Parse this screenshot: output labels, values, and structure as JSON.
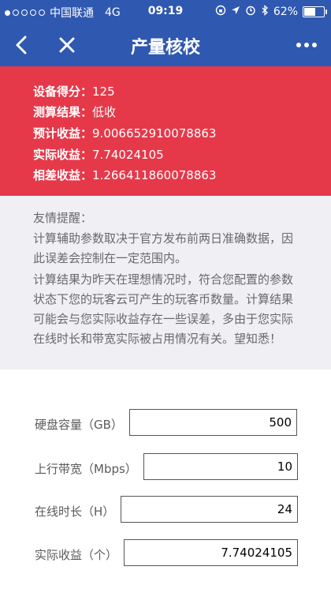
{
  "statusbar": {
    "carrier": "中国联通",
    "network": "4G",
    "time": "09:19",
    "battery": "62%",
    "battery_level": 0.62
  },
  "navbar": {
    "title": "产量核校"
  },
  "result": {
    "rows": [
      {
        "label": "设备得分：",
        "value": "125"
      },
      {
        "label": "测算结果：",
        "value": "低收"
      },
      {
        "label": "预计收益：",
        "value": "9.006652910078863"
      },
      {
        "label": "实际收益：",
        "value": "7.74024105"
      },
      {
        "label": "相差收益：",
        "value": "1.266411860078863"
      }
    ]
  },
  "reminder": {
    "title": "友情提醒：",
    "p1": "计算辅助参数取决于官方发布前两日准确数据，因此误差会控制在一定范围内。",
    "p2": "计算结果为昨天在理想情况时，符合您配置的参数状态下您的玩客云可产生的玩客币数量。计算结果可能会与您实际收益存在一些误差，多由于您实际在线时长和带宽实际被占用情况有关。望知悉！"
  },
  "form": {
    "fields": [
      {
        "label": "硬盘容量（GB）",
        "value": "500"
      },
      {
        "label": "上行带宽（Mbps）",
        "value": "10"
      },
      {
        "label": "在线时长（H）",
        "value": "24"
      },
      {
        "label": "实际收益（个）",
        "value": "7.74024105"
      }
    ]
  },
  "colors": {
    "navbar": "#2f58b0",
    "result_panel": "#e5394a",
    "reminder_bg": "#efeff4"
  }
}
